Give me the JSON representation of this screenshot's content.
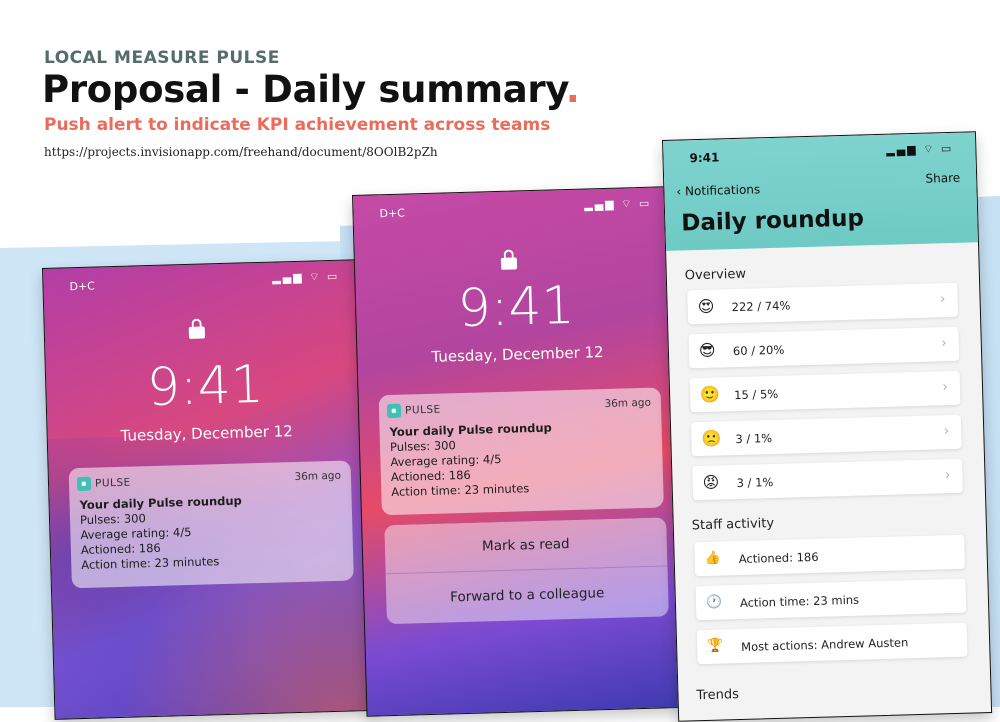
{
  "header": {
    "eyebrow": "LOCAL MEASURE PULSE",
    "title": "Proposal - Daily summary",
    "title_dot": ".",
    "subtitle": "Push alert to indicate KPI achievement across teams",
    "link": "https://projects.invisionapp.com/freehand/document/8OOlB2pZh"
  },
  "colors": {
    "accent": "#ec6c5b",
    "teal": "#6ecac4",
    "eyebrow": "#566c69"
  },
  "lockscreen": {
    "carrier": "D+C",
    "status_icons": "▂▄▆ ⌔ ▭",
    "time": "9:41",
    "date": "Tuesday, December 12"
  },
  "notification": {
    "app_name": "PULSE",
    "ago": "36m ago",
    "title": "Your daily Pulse roundup",
    "lines": [
      "Pulses: 300",
      "Average rating: 4/5",
      "Actioned: 186",
      "Action time: 23 minutes"
    ]
  },
  "actions": {
    "mark_read": "Mark as read",
    "forward": "Forward to a colleague"
  },
  "roundup": {
    "clock": "9:41",
    "back_label": "Notifications",
    "share_label": "Share",
    "heading": "Daily roundup",
    "overview_label": "Overview",
    "overview": [
      {
        "emoji": "😍",
        "value": "222 / 74%"
      },
      {
        "emoji": "😎",
        "value": "60 / 20%"
      },
      {
        "emoji": "🙂",
        "value": "15 / 5%"
      },
      {
        "emoji": "🙁",
        "value": "3 / 1%"
      },
      {
        "emoji": "😡",
        "value": "3 / 1%"
      }
    ],
    "staff_label": "Staff activity",
    "staff": [
      {
        "icon": "👍",
        "value": "Actioned: 186"
      },
      {
        "icon": "🕐",
        "value": "Action time: 23 mins"
      },
      {
        "icon": "🏆",
        "value": "Most actions: Andrew Austen"
      }
    ],
    "trends_label": "Trends"
  }
}
